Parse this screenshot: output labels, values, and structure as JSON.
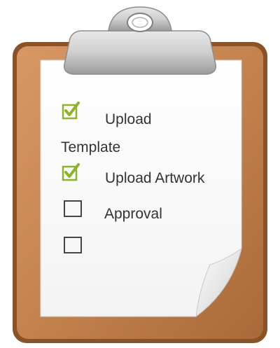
{
  "checklist": {
    "items": [
      {
        "label_line1": "Upload",
        "label_line2": "Template",
        "checked": true
      },
      {
        "label": "Upload Artwork",
        "checked": true
      },
      {
        "label": "Approval",
        "checked": false
      },
      {
        "label": "",
        "checked": false
      }
    ]
  },
  "colors": {
    "board": "#c4834e",
    "board_edge": "#8a5228",
    "clip": "#c9c9c9",
    "paper": "#fbfbfb",
    "check": "#8fb32a",
    "box": "#333333",
    "text": "#333333"
  }
}
